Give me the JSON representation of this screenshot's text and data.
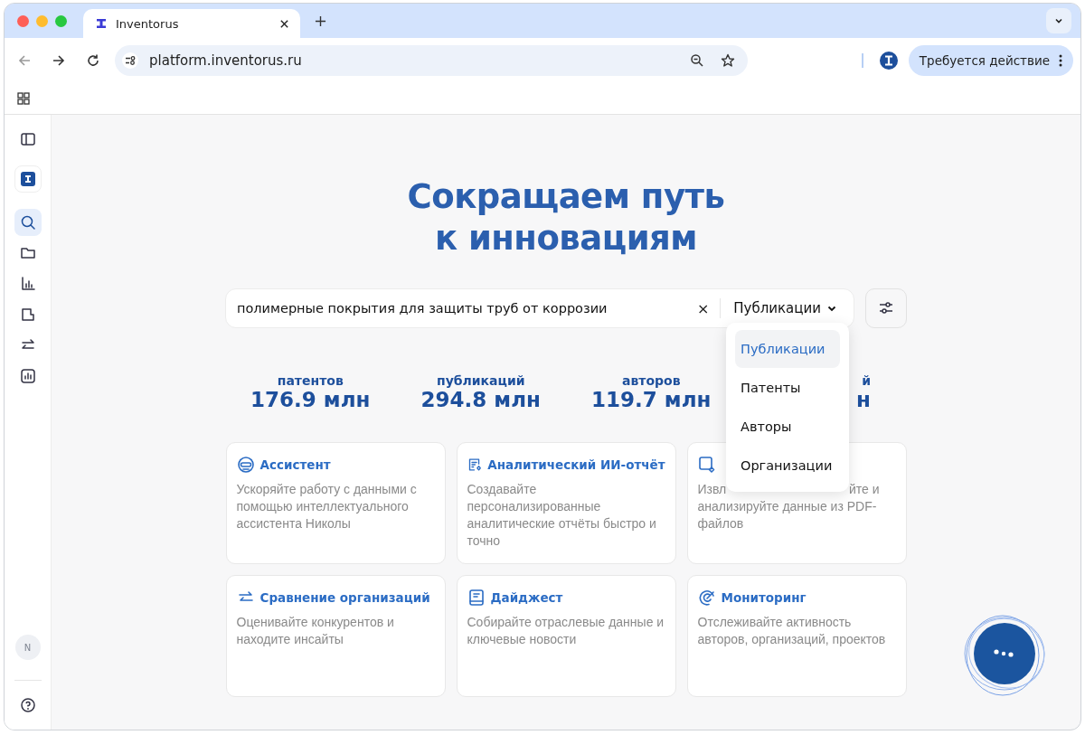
{
  "browser": {
    "tab_title": "Inventorus",
    "url": "platform.inventorus.ru",
    "action_button": "Требуется действие"
  },
  "sidebar": {
    "items": [
      {
        "selected": true
      },
      {
        "selected": false
      },
      {
        "selected": false
      },
      {
        "selected": false
      },
      {
        "selected": false
      },
      {
        "selected": false
      }
    ],
    "avatar": "N"
  },
  "hero": {
    "title_line_1": "Сокращаем путь",
    "title_line_2": "к инновациям"
  },
  "search": {
    "value": "полимерные покрытия для защиты труб от коррозии",
    "clear": "×",
    "scope": "Публикации"
  },
  "scope_menu": [
    {
      "label": "Публикации",
      "selected": true
    },
    {
      "label": "Патенты",
      "selected": false
    },
    {
      "label": "Авторы",
      "selected": false
    },
    {
      "label": "Организации",
      "selected": false
    }
  ],
  "stats": [
    {
      "label": "патентов",
      "value": "176.9 млн"
    },
    {
      "label": "публикаций",
      "value": "294.8 млн"
    },
    {
      "label": "авторов",
      "value": "119.7 млн"
    },
    {
      "label": "й",
      "value": "н"
    }
  ],
  "cards": [
    {
      "kind": "full",
      "title": "Ассистент",
      "description": "Ускоряйте работу с данными с помощью интеллектуального ассистента Николы"
    },
    {
      "kind": "full",
      "title": "Аналитический ИИ-отчёт",
      "description": "Создавайте персонализированные аналитические отчёты быстро и точно"
    },
    {
      "kind": "covered",
      "fragments": [
        "Извл",
        "йте и"
      ],
      "description": "анализируйте данные из PDF-файлов"
    },
    {
      "kind": "full",
      "title": "Сравнение организаций",
      "description": "Оценивайте конкурентов и находите инсайты"
    },
    {
      "kind": "full",
      "title": "Дайджест",
      "description": "Собирайте отраслевые данные и ключевые новости"
    },
    {
      "kind": "full",
      "title": "Мониторинг",
      "description": "Отслеживайте активность авторов, организаций, проектов"
    }
  ]
}
